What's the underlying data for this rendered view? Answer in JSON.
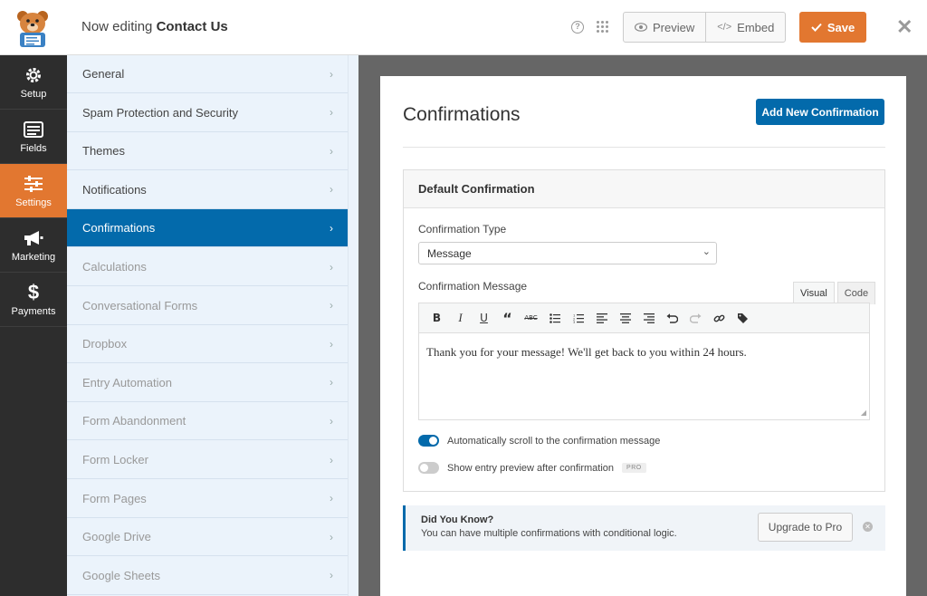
{
  "header": {
    "editing_prefix": "Now editing",
    "form_name": "Contact Us",
    "preview_label": "Preview",
    "embed_label": "Embed",
    "save_label": "Save"
  },
  "leftnav": [
    {
      "label": "Setup",
      "icon": "gear-icon",
      "active": false
    },
    {
      "label": "Fields",
      "icon": "fields-icon",
      "active": false
    },
    {
      "label": "Settings",
      "icon": "sliders-icon",
      "active": true
    },
    {
      "label": "Marketing",
      "icon": "megaphone-icon",
      "active": false
    },
    {
      "label": "Payments",
      "icon": "dollar-icon",
      "active": false
    }
  ],
  "panel": {
    "items": [
      {
        "label": "General",
        "state": "normal"
      },
      {
        "label": "Spam Protection and Security",
        "state": "normal"
      },
      {
        "label": "Themes",
        "state": "normal"
      },
      {
        "label": "Notifications",
        "state": "normal"
      },
      {
        "label": "Confirmations",
        "state": "active"
      },
      {
        "label": "Calculations",
        "state": "dim"
      },
      {
        "label": "Conversational Forms",
        "state": "dim"
      },
      {
        "label": "Dropbox",
        "state": "dim"
      },
      {
        "label": "Entry Automation",
        "state": "dim"
      },
      {
        "label": "Form Abandonment",
        "state": "dim"
      },
      {
        "label": "Form Locker",
        "state": "dim"
      },
      {
        "label": "Form Pages",
        "state": "dim"
      },
      {
        "label": "Google Drive",
        "state": "dim"
      },
      {
        "label": "Google Sheets",
        "state": "dim"
      }
    ]
  },
  "main": {
    "title": "Confirmations",
    "add_button": "Add New Confirmation",
    "box_title": "Default Confirmation",
    "type_label": "Confirmation Type",
    "type_value": "Message",
    "message_label": "Confirmation Message",
    "tab_visual": "Visual",
    "tab_code": "Code",
    "toolbar": [
      "B",
      "I",
      "U",
      "“",
      "ABC",
      "ul",
      "ol",
      "al",
      "ac",
      "ar",
      "undo",
      "redo",
      "link",
      "tag"
    ],
    "message_text": "Thank you for your message! We'll get back to you within 24 hours.",
    "toggle1_label": "Automatically scroll to the confirmation message",
    "toggle1_on": true,
    "toggle2_label": "Show entry preview after confirmation",
    "toggle2_on": false,
    "pro_badge": "PRO"
  },
  "notice": {
    "title": "Did You Know?",
    "text": "You can have multiple confirmations with conditional logic.",
    "button": "Upgrade to Pro"
  },
  "colors": {
    "accent_orange": "#e27730",
    "accent_blue": "#036aab"
  }
}
